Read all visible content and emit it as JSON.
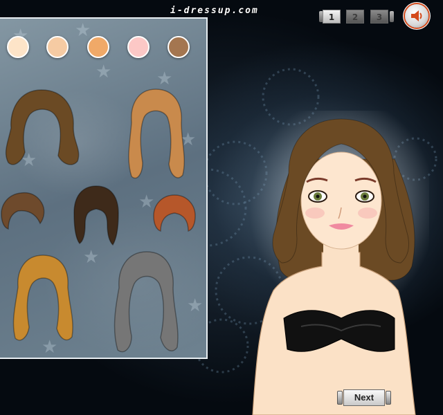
{
  "site": {
    "brand": "i-dressup.com"
  },
  "pager": {
    "pages": [
      "1",
      "2",
      "3"
    ],
    "current": "1"
  },
  "sound": {
    "icon": "speaker-icon"
  },
  "skin_tones": [
    "#fde4c8",
    "#f6cba3",
    "#f0a968",
    "#fcc8c6",
    "#a47650"
  ],
  "hair_styles": [
    {
      "id": "hair-brown-wavy",
      "color": "#6b4a24"
    },
    {
      "id": "hair-strawberry-blonde-long",
      "color": "#c98a4c"
    },
    {
      "id": "hair-brown-short",
      "color": "#6e4a2c"
    },
    {
      "id": "hair-dark-bob",
      "color": "#3e2a1a"
    },
    {
      "id": "hair-auburn-short",
      "color": "#b6572a"
    },
    {
      "id": "hair-golden-curly",
      "color": "#c88a2f"
    },
    {
      "id": "hair-grey-curly-long",
      "color": "#767676"
    }
  ],
  "controls": {
    "next_label": "Next"
  }
}
